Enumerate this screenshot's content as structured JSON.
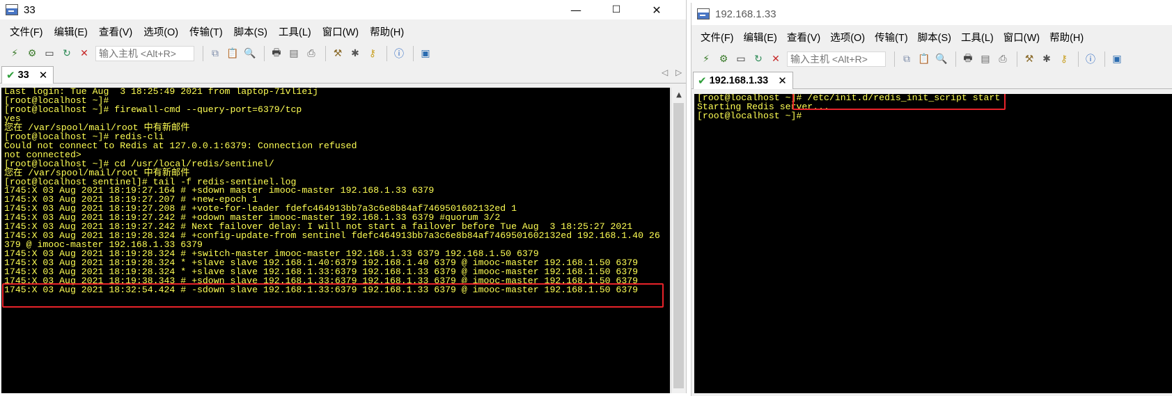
{
  "left_window": {
    "title": "33",
    "controls": {
      "minimize": "—",
      "maximize": "☐",
      "close": "✕"
    },
    "menu": [
      "文件(F)",
      "编辑(E)",
      "查看(V)",
      "选项(O)",
      "传输(T)",
      "脚本(S)",
      "工具(L)",
      "窗口(W)",
      "帮助(H)"
    ],
    "host_input_placeholder": "输入主机 <Alt+R>",
    "tab": {
      "label": "33",
      "close": "✕"
    },
    "tab_nav": {
      "prev": "◁",
      "next": "▷"
    },
    "terminal_lines": [
      "Last login: Tue Aug  3 18:25:49 2021 from laptop-71vl1eij",
      "[root@localhost ~]#",
      "[root@localhost ~]# firewall-cmd --query-port=6379/tcp",
      "yes",
      "您在 /var/spool/mail/root 中有新邮件",
      "[root@localhost ~]# redis-cli",
      "Could not connect to Redis at 127.0.0.1:6379: Connection refused",
      "not connected>",
      "[root@localhost ~]# cd /usr/local/redis/sentinel/",
      "您在 /var/spool/mail/root 中有新邮件",
      "[root@localhost sentinel]# tail -f redis-sentinel.log",
      "1745:X 03 Aug 2021 18:19:27.164 # +sdown master imooc-master 192.168.1.33 6379",
      "1745:X 03 Aug 2021 18:19:27.207 # +new-epoch 1",
      "1745:X 03 Aug 2021 18:19:27.208 # +vote-for-leader fdefc464913bb7a3c6e8b84af7469501602132ed 1",
      "1745:X 03 Aug 2021 18:19:27.242 # +odown master imooc-master 192.168.1.33 6379 #quorum 3/2",
      "1745:X 03 Aug 2021 18:19:27.242 # Next failover delay: I will not start a failover before Tue Aug  3 18:25:27 2021",
      "1745:X 03 Aug 2021 18:19:28.324 # +config-update-from sentinel fdefc464913bb7a3c6e8b84af7469501602132ed 192.168.1.40 26",
      "379 @ imooc-master 192.168.1.33 6379",
      "1745:X 03 Aug 2021 18:19:28.324 # +switch-master imooc-master 192.168.1.33 6379 192.168.1.50 6379",
      "1745:X 03 Aug 2021 18:19:28.324 * +slave slave 192.168.1.40:6379 192.168.1.40 6379 @ imooc-master 192.168.1.50 6379",
      "1745:X 03 Aug 2021 18:19:28.324 * +slave slave 192.168.1.33:6379 192.168.1.33 6379 @ imooc-master 192.168.1.50 6379",
      "1745:X 03 Aug 2021 18:19:38.343 # +sdown slave 192.168.1.33:6379 192.168.1.33 6379 @ imooc-master 192.168.1.50 6379",
      "1745:X 03 Aug 2021 18:32:54.424 # -sdown slave 192.168.1.33:6379 192.168.1.33 6379 @ imooc-master 192.168.1.50 6379"
    ],
    "scroll_up": "▲"
  },
  "right_window": {
    "title": "192.168.1.33",
    "menu": [
      "文件(F)",
      "编辑(E)",
      "查看(V)",
      "选项(O)",
      "传输(T)",
      "脚本(S)",
      "工具(L)",
      "窗口(W)",
      "帮助(H)"
    ],
    "host_input_placeholder": "输入主机 <Alt+R>",
    "tab": {
      "label": "192.168.1.33",
      "close": "✕"
    },
    "terminal_lines": [
      "[root@localhost ~]# /etc/init.d/redis_init_script start",
      "Starting Redis server...",
      "[root@localhost ~]#"
    ]
  },
  "colors": {
    "terminal_bg": "#000000",
    "terminal_text": "#ffff54",
    "highlight_box": "#e8232a",
    "tab_check": "#2e9e3a"
  },
  "toolbar_icons": [
    "connect-icon",
    "quick-connect-icon",
    "connect-tab-icon",
    "reconnect-icon",
    "disconnect-icon",
    "copy-icon",
    "paste-icon",
    "find-icon",
    "print-icon",
    "print-setup-icon",
    "print-screen-icon",
    "session-options-icon",
    "global-options-icon",
    "keymap-icon",
    "help-icon",
    "screen-icon"
  ]
}
